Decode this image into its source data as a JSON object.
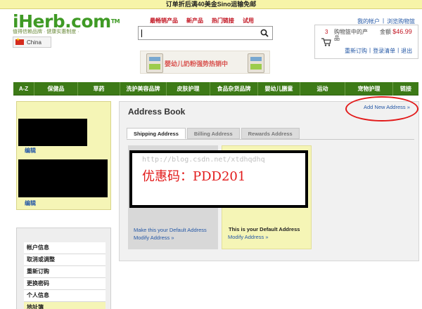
{
  "promo_bar": "订单折后满40美金Sino运输免邮",
  "logo": {
    "text": "iHerb.com",
    "tm": "TM",
    "tagline": "值得信赖品牌 · 健康实惠制度 ·"
  },
  "country": "China",
  "main_nav": [
    "最畅销产品",
    "新产品",
    "热门链接",
    "试用"
  ],
  "search": {
    "value": "",
    "placeholder": ""
  },
  "banner": {
    "text": "婴幼儿奶粉强势热销中"
  },
  "account": {
    "my_account": "我的帐户",
    "separator": "|",
    "browse_cart": "浏览购物篮"
  },
  "cart": {
    "count": "3",
    "label": "购物篮中的产品",
    "total_label": "金额",
    "total": "$46.99"
  },
  "cart_links": [
    "重新订购",
    "登录清单",
    "退出"
  ],
  "categories": [
    "A-Z",
    "保健品",
    "草药",
    "洗护美容品牌",
    "皮肤护理",
    "食品杂货品牌",
    "婴幼儿膳童",
    "运动",
    "宠物护理",
    "链接"
  ],
  "left_panel": {
    "edit1": "编辑",
    "edit2": "编辑"
  },
  "left_menu": [
    "帐户信息",
    "取消或调整",
    "重新订购",
    "更换密码",
    "个人信息",
    "地址簿"
  ],
  "address_book": {
    "title": "Address Book",
    "add_new": "Add New Address »",
    "tabs": [
      "Shipping Address",
      "Billing Address",
      "Rewards Address"
    ],
    "card1": {
      "make_default": "Make this your Default Address",
      "modify": "Modify Address »"
    },
    "card2": {
      "is_default": "This is your Default Address",
      "modify": "Modify Address »"
    }
  },
  "coupon": {
    "watermark": "http://blog.csdn.net/xtdhqdhq",
    "code_text": "优惠码：PDD201"
  },
  "colors": {
    "green": "#3d7a17",
    "red": "#e21a1a",
    "link": "#2558a6",
    "yellow": "#f5f5b6"
  }
}
